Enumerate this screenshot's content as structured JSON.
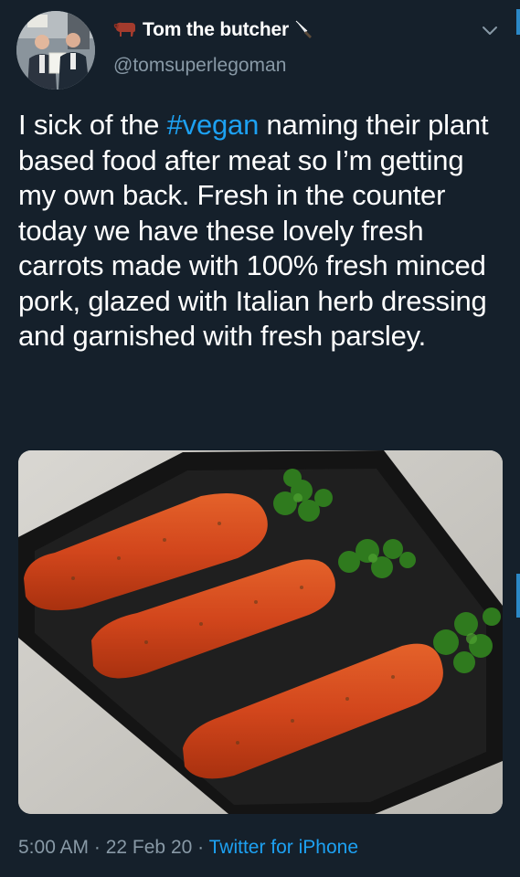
{
  "tweet": {
    "author": {
      "display_name": "Tom the butcher",
      "handle": "@tomsuperlegoman",
      "name_prefix_icon": "cow-emoji",
      "name_suffix_icon": "knife-emoji"
    },
    "menu_icon": "chevron-down-icon",
    "text": {
      "before_hashtag": "I sick of the ",
      "hashtag": "#vegan",
      "after_hashtag": "  naming their plant based food after meat so I’m getting my own back. Fresh in the counter today we have these lovely fresh carrots made with 100% fresh minced pork, glazed with Italian herb dressing and garnished with fresh parsley."
    },
    "image": {
      "subject": "three-minced-pork-carrots-with-parsley-on-black-tray"
    },
    "footer": {
      "time": "5:00 AM",
      "separator": " · ",
      "date": "22 Feb 20",
      "source": "Twitter for iPhone"
    }
  },
  "colors": {
    "background": "#15202b",
    "text_primary": "#ffffff",
    "text_secondary": "#8899a6",
    "accent": "#1da1f2"
  }
}
